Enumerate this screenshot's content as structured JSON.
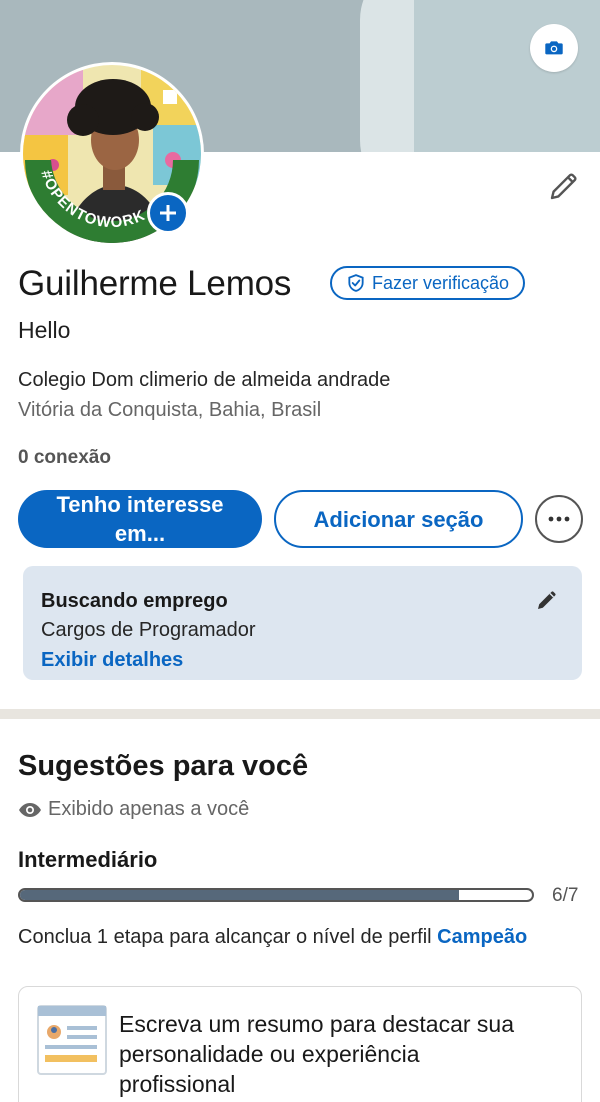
{
  "profile": {
    "name": "Guilherme Lemos",
    "verify_label": "Fazer verificação",
    "headline": "Hello",
    "company": "Colegio Dom climerio de almeida andrade",
    "location": "Vitória da Conquista, Bahia, Brasil",
    "connections": "0 conexão",
    "avatar_frame_text": "#OPENTOWORK"
  },
  "actions": {
    "primary_label": "Tenho interesse em...",
    "secondary_label": "Adicionar seção",
    "more_icon": "ellipsis-icon"
  },
  "open_to_work": {
    "title": "Buscando emprego",
    "subtitle": "Cargos de Programador",
    "link": "Exibir detalhes"
  },
  "suggestions": {
    "title": "Sugestões para você",
    "privacy_note": "Exibido apenas a você",
    "level": "Intermediário",
    "progress_current": 6,
    "progress_total": 7,
    "progress_text": "6/7",
    "cta_prefix": "Conclua 1 etapa para alcançar o nível de perfil ",
    "cta_level": "Campeão",
    "card_text": "Escreva um resumo para destacar sua personalidade ou experiência profissional"
  },
  "colors": {
    "brand_blue": "#0a66c2",
    "open_to_work_green": "#2e7d32",
    "card_bg": "#dde6f0",
    "progress_fill": "#56687a"
  },
  "icons": {
    "camera": "camera-icon",
    "edit": "pencil-icon",
    "add": "plus-icon",
    "verify": "shield-check-icon",
    "eye": "eye-icon"
  }
}
